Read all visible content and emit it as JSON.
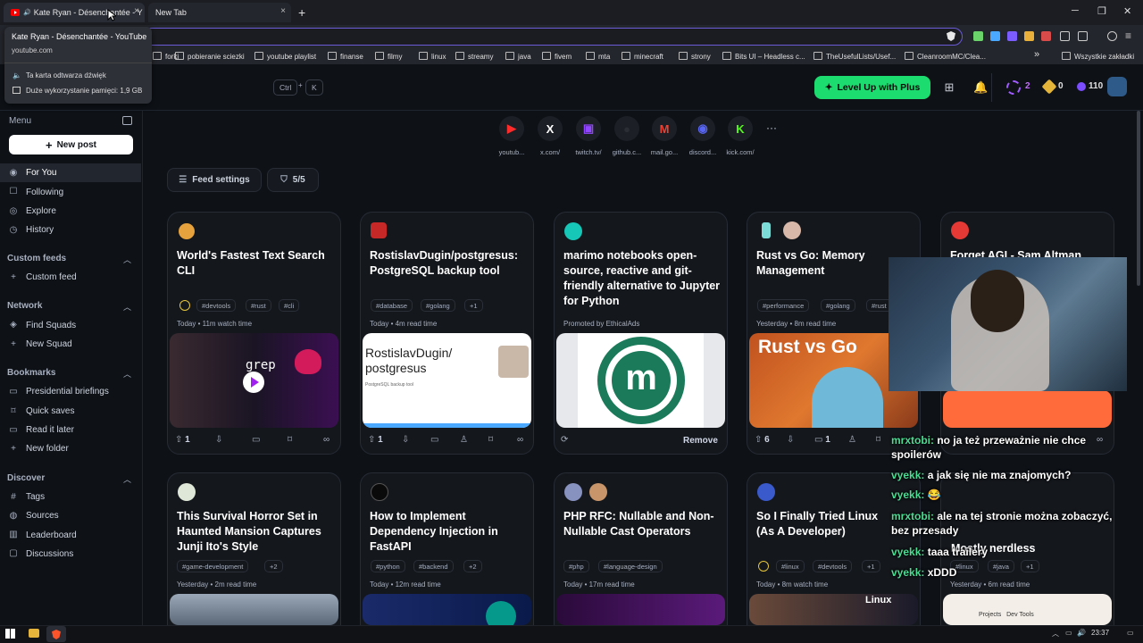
{
  "browser": {
    "tabs": [
      {
        "title": "Kate Ryan - Désenchantée - Y"
      },
      {
        "title": "New Tab"
      }
    ],
    "new_tab_symbol": "+",
    "close_symbol": "×",
    "window_controls": [
      "─",
      "❐",
      "✕"
    ],
    "tooltip": {
      "title": "Kate Ryan - Désenchantée - YouTube",
      "domain": "youtube.com",
      "audio": "Ta karta odtwarza dźwięk",
      "memory": "Duże wykorzystanie pamięci: 1,9 GB"
    },
    "bookmarks": [
      "forki",
      "pobieranie sciezki",
      "youtube playlist",
      "finanse",
      "filmy",
      "linux",
      "streamy",
      "java",
      "fivem",
      "mta",
      "minecraft",
      "strony",
      "Bits UI – Headless c...",
      "TheUsefulLists/Usef...",
      "CleanroomMC/Clea..."
    ],
    "bookmarks_more": "»",
    "all_bookmarks": "Wszystkie zakładki"
  },
  "header": {
    "shortcut_keys": [
      "Ctrl",
      "+",
      "K"
    ],
    "level_up": "Level Up with Plus",
    "streak": "2",
    "cores": "0",
    "reputation": "110"
  },
  "sidebar": {
    "menu_label": "Menu",
    "new_post": "New post",
    "main": [
      {
        "label": "For You",
        "icon": "feed-icon"
      },
      {
        "label": "Following",
        "icon": "following-icon"
      },
      {
        "label": "Explore",
        "icon": "explore-icon"
      },
      {
        "label": "History",
        "icon": "history-icon"
      }
    ],
    "custom_feeds": {
      "title": "Custom feeds",
      "items": [
        {
          "label": "Custom feed"
        }
      ]
    },
    "network": {
      "title": "Network",
      "items": [
        {
          "label": "Find Squads"
        },
        {
          "label": "New Squad"
        }
      ]
    },
    "bookmarks": {
      "title": "Bookmarks",
      "items": [
        {
          "label": "Presidential briefings"
        },
        {
          "label": "Quick saves"
        },
        {
          "label": "Read it later"
        },
        {
          "label": "New folder"
        }
      ]
    },
    "discover": {
      "title": "Discover",
      "items": [
        {
          "label": "Tags"
        },
        {
          "label": "Sources"
        },
        {
          "label": "Leaderboard"
        },
        {
          "label": "Discussions"
        }
      ]
    }
  },
  "social": [
    {
      "label": "youtub...",
      "glyph": "▶",
      "color": "#ff2a2a"
    },
    {
      "label": "x.com/",
      "glyph": "X",
      "color": "#ffffff"
    },
    {
      "label": "twitch.tv/",
      "glyph": "▣",
      "color": "#9146ff"
    },
    {
      "label": "github.c...",
      "glyph": "●",
      "color": "#2a2d33"
    },
    {
      "label": "mail.go...",
      "glyph": "M",
      "color": "#ea4335"
    },
    {
      "label": "discord...",
      "glyph": "◉",
      "color": "#5865f2"
    },
    {
      "label": "kick.com/",
      "glyph": "K",
      "color": "#53fc18"
    }
  ],
  "social_more": "···",
  "feed": {
    "settings": "Feed settings",
    "count": "5/5"
  },
  "cards_row1": [
    {
      "title": "World's Fastest Text Search CLI",
      "tags": [
        "#devtools",
        "#rust",
        "#cli"
      ],
      "meta": "Today • 11m watch time",
      "upvotes": "1",
      "image_text": "grep"
    },
    {
      "title": "RostislavDugin/postgresus: PostgreSQL backup tool",
      "tags": [
        "#database",
        "#golang",
        "+1"
      ],
      "meta": "Today • 4m read time",
      "upvotes": "1",
      "image_text": "RostislavDugin/ postgresus",
      "image_sub": "PostgreSQL backup tool"
    },
    {
      "title": "marimo notebooks open-source, reactive and git-friendly alternative to Jupyter for Python",
      "tags": [],
      "meta": "Promoted by EthicalAds",
      "remove": "Remove",
      "image_text": "m"
    },
    {
      "title": "Rust vs Go: Memory Management",
      "tags": [
        "#performance",
        "#golang",
        "#rust"
      ],
      "meta": "Yesterday • 8m read time",
      "upvotes": "6",
      "comments": "1",
      "image_text": "Rust vs Go"
    },
    {
      "title": "Forget AGI - Sam Altman",
      "tags": [],
      "meta": "",
      "image_text": ""
    }
  ],
  "cards_row2": [
    {
      "title": "This Survival Horror Set in Haunted Mansion Captures Junji Ito's Style",
      "tags": [
        "#game-development",
        "+2"
      ],
      "meta": "Yesterday • 2m read time"
    },
    {
      "title": "How to Implement Dependency Injection in FastAPI",
      "tags": [
        "#python",
        "#backend",
        "+2"
      ],
      "meta": "Today • 12m read time"
    },
    {
      "title": "PHP RFC: Nullable and Non-Nullable Cast Operators",
      "tags": [
        "#php",
        "#language-design"
      ],
      "meta": "Today • 17m read time"
    },
    {
      "title": "So I Finally Tried Linux (As A Developer)",
      "tags": [
        "#linux",
        "#devtools",
        "+1"
      ],
      "meta": "Today • 8m watch time",
      "image_text": "Linux"
    },
    {
      "title": "Mostly nerdless",
      "tags": [
        "#linux",
        "#java",
        "+1"
      ],
      "meta": "Yesterday • 6m read time",
      "image_text": "Projects   Dev Tools"
    }
  ],
  "chat": [
    {
      "user": "mrxtobi:",
      "text": "no ja też przeważnie nie chce spoilerów"
    },
    {
      "user": "vyekk:",
      "text": "a jak się nie ma znajomych?"
    },
    {
      "user": "vyekk:",
      "text": "😂"
    },
    {
      "user": "mrxtobi:",
      "text": "ale na tej stronie można zobaczyć, bez przesady"
    },
    {
      "user": "vyekk:",
      "text": "taaa trailery"
    },
    {
      "user": "vyekk:",
      "text": "xDDD"
    }
  ],
  "taskbar": {
    "time": "23:37"
  }
}
